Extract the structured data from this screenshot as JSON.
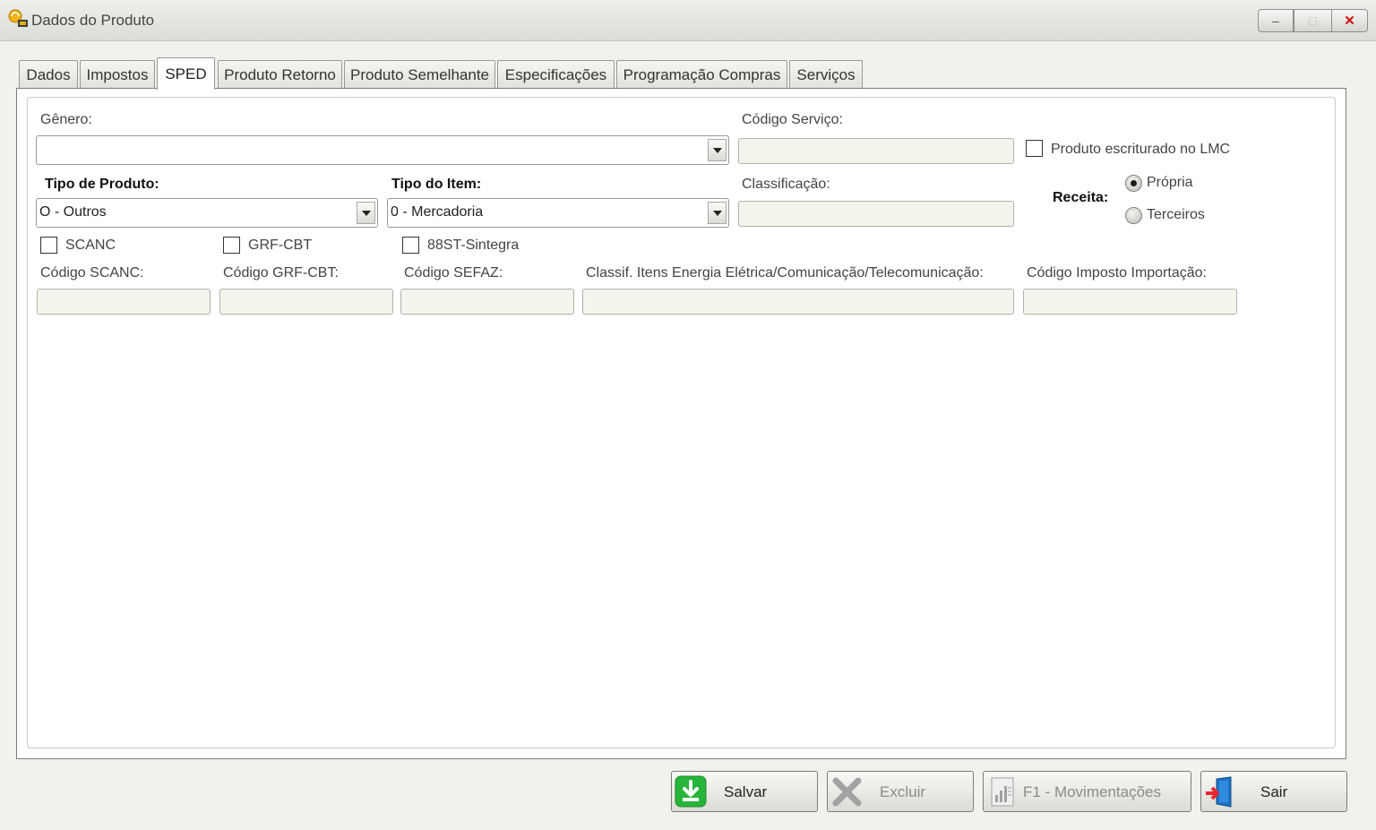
{
  "window": {
    "title": "Dados do Produto",
    "icon": "product-app-icon",
    "controls": {
      "minimize": "–",
      "maximize": "□",
      "close": "✕"
    }
  },
  "tabs": [
    {
      "label": "Dados",
      "active": false
    },
    {
      "label": "Impostos",
      "active": false
    },
    {
      "label": "SPED",
      "active": true
    },
    {
      "label": "Produto Retorno",
      "active": false
    },
    {
      "label": "Produto Semelhante",
      "active": false
    },
    {
      "label": "Especificações",
      "active": false
    },
    {
      "label": "Programação Compras",
      "active": false
    },
    {
      "label": "Serviços",
      "active": false
    }
  ],
  "form": {
    "genero": {
      "label": "Gênero:",
      "value": ""
    },
    "codigo_servico": {
      "label": "Código Serviço:",
      "value": ""
    },
    "produto_lmc": {
      "label": "Produto escriturado no LMC",
      "checked": false
    },
    "tipo_produto": {
      "label": "Tipo de Produto:",
      "value": "O - Outros"
    },
    "tipo_item": {
      "label": "Tipo do Item:",
      "value": "0 - Mercadoria"
    },
    "classificacao": {
      "label": "Classificação:",
      "value": ""
    },
    "receita": {
      "label": "Receita:",
      "options": [
        {
          "label": "Própria",
          "checked": true
        },
        {
          "label": "Terceiros",
          "checked": false
        }
      ]
    },
    "scanc": {
      "label": "SCANC",
      "checked": false
    },
    "grf_cbt": {
      "label": "GRF-CBT",
      "checked": false
    },
    "sintegra_88st": {
      "label": "88ST-Sintegra",
      "checked": false
    },
    "codigo_scanc": {
      "label": "Código SCANC:",
      "value": ""
    },
    "codigo_grf_cbt": {
      "label": "Código GRF-CBT:",
      "value": ""
    },
    "codigo_sefaz": {
      "label": "Código SEFAZ:",
      "value": ""
    },
    "classif_energia": {
      "label": "Classif. Itens Energia Elétrica/Comunicação/Telecomunicação:",
      "value": ""
    },
    "codigo_imposto_importacao": {
      "label": "Código Imposto Importação:",
      "value": ""
    }
  },
  "buttons": {
    "salvar": {
      "label": "Salvar",
      "enabled": true,
      "icon": "download-arrow-icon"
    },
    "excluir": {
      "label": "Excluir",
      "enabled": false,
      "icon": "delete-x-icon"
    },
    "movimentacoes": {
      "label": "F1 - Movimentações",
      "enabled": false,
      "icon": "report-chart-icon"
    },
    "sair": {
      "label": "Sair",
      "enabled": true,
      "icon": "exit-door-icon"
    }
  },
  "colors": {
    "salvar_icon": "#27b43a",
    "sair_door": "#1f73c4",
    "sair_arrow": "#e8262d",
    "close_x": "#d21212",
    "textbox_bg": "#f4f3ec"
  }
}
